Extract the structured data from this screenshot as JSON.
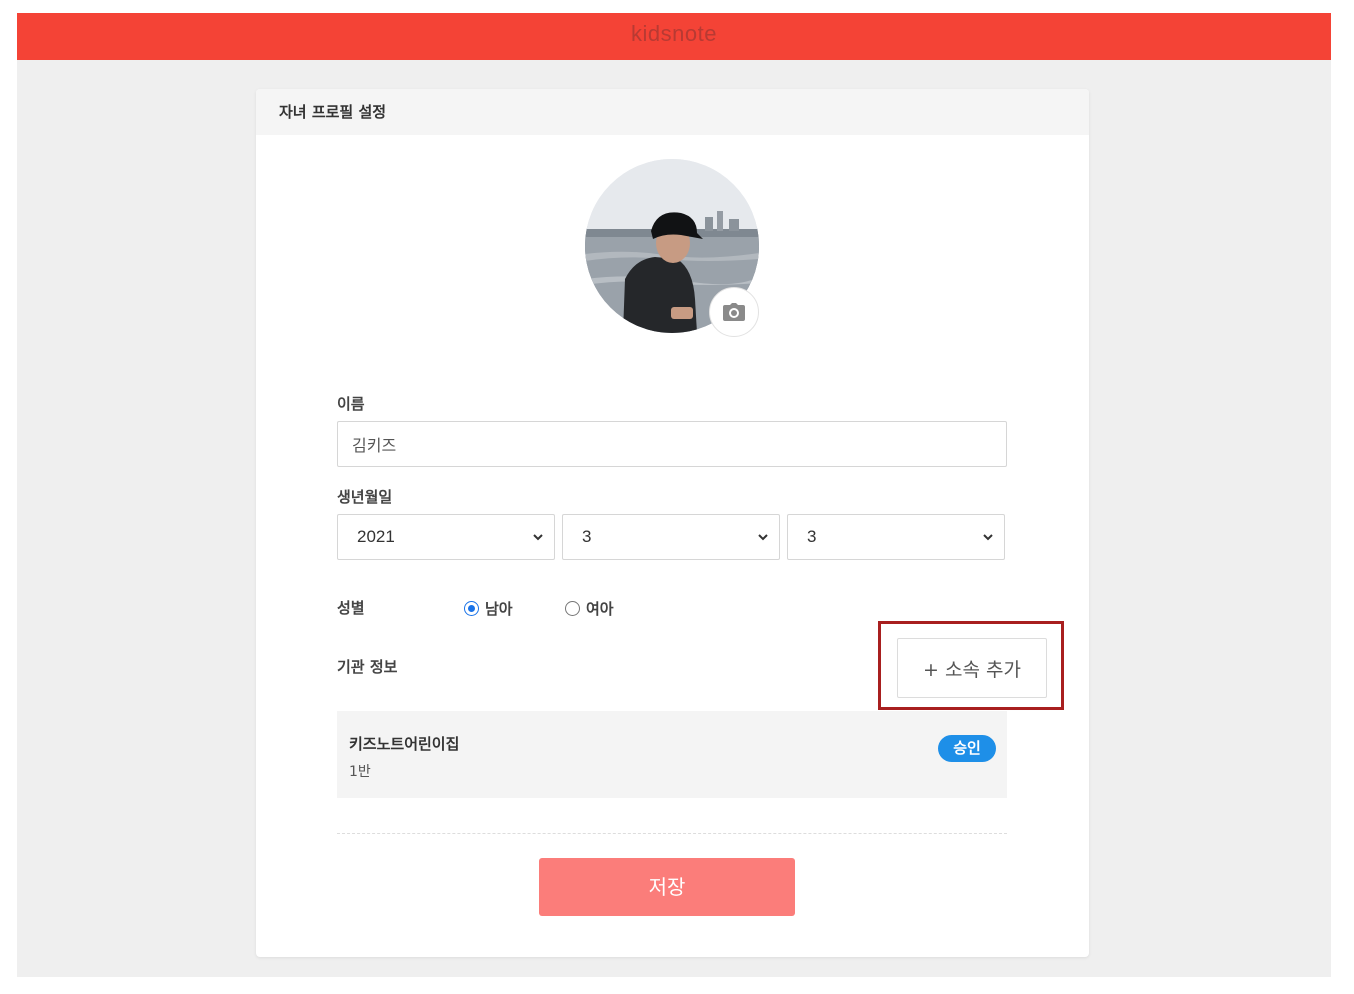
{
  "app": {
    "brand": "kidsnote",
    "brand_color": "#f44336"
  },
  "card": {
    "title": "자녀 프로필 설정"
  },
  "avatar": {
    "camera_icon": "camera-icon"
  },
  "form": {
    "name_label": "이름",
    "name_value": "김키즈",
    "birth_label": "생년월일",
    "birth_year": "2021",
    "birth_month": "3",
    "birth_day": "3",
    "gender_label": "성별",
    "gender_options": [
      {
        "label": "남아",
        "checked": true
      },
      {
        "label": "여아",
        "checked": false
      }
    ],
    "org_label": "기관 정보",
    "add_org_button": "+ 소속 추가"
  },
  "organization": {
    "name": "키즈노트어린이집",
    "class": "1반",
    "status": "승인",
    "status_color": "#1e8fe8"
  },
  "actions": {
    "save_label": "저장",
    "save_color": "#fb7d7a"
  }
}
